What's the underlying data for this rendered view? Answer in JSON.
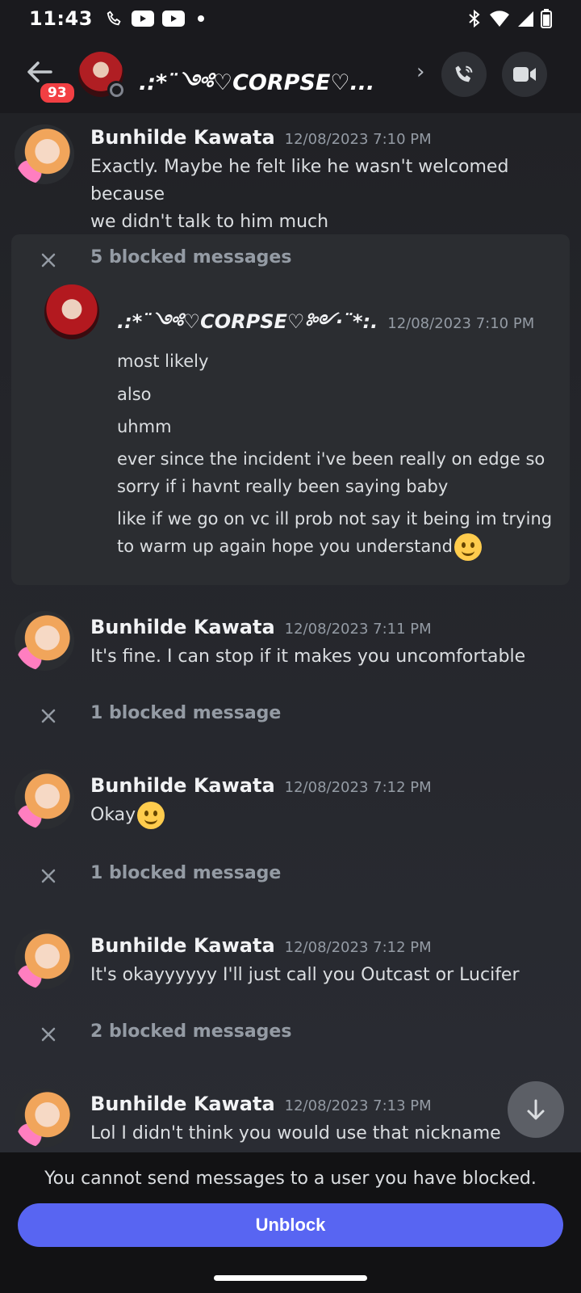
{
  "status_bar": {
    "time": "11:43"
  },
  "header": {
    "unread_badge": "93",
    "title": ".:*¨༺♡CORPSE♡..."
  },
  "messages": [
    {
      "author": "Bunhilde Kawata",
      "timestamp": "12/08/2023 7:10 PM",
      "lines": [
        "Exactly. Maybe he felt like he wasn't welcomed because",
        "we didn't talk to him much"
      ]
    },
    {
      "author": "Bunhilde Kawata",
      "timestamp": "12/08/2023 7:11 PM",
      "lines": [
        "It's fine. I can stop if it makes you uncomfortable"
      ]
    },
    {
      "author": "Bunhilde Kawata",
      "timestamp": "12/08/2023 7:12 PM",
      "lines": [
        "Okay"
      ]
    },
    {
      "author": "Bunhilde Kawata",
      "timestamp": "12/08/2023 7:12 PM",
      "lines": [
        "It's okayyyyyy I'll just call you Outcast or Lucifer"
      ]
    },
    {
      "author": "Bunhilde Kawata",
      "timestamp": "12/08/2023 7:13 PM",
      "lines": [
        "Lol I didn't think you would use that nickname"
      ]
    }
  ],
  "blocked_group": {
    "label": "5 blocked messages",
    "author": ".:*¨༺♡CORPSE♡༻·¨*:.",
    "timestamp": "12/08/2023 7:10 PM",
    "lines": [
      "most likely",
      "also",
      "uhmm",
      "ever since the incident i've been really on edge so",
      "sorry if i havnt really been saying baby",
      "like if we go on vc ill prob not say it being im trying",
      "to warm up again hope you understand"
    ]
  },
  "blocked_rows": [
    "1 blocked message",
    "1 blocked message",
    "2 blocked messages"
  ],
  "footer": {
    "notice": "You cannot send messages to a user you have blocked.",
    "unblock_label": "Unblock"
  },
  "colors": {
    "accent": "#5865f2",
    "badge": "#f23f43"
  }
}
